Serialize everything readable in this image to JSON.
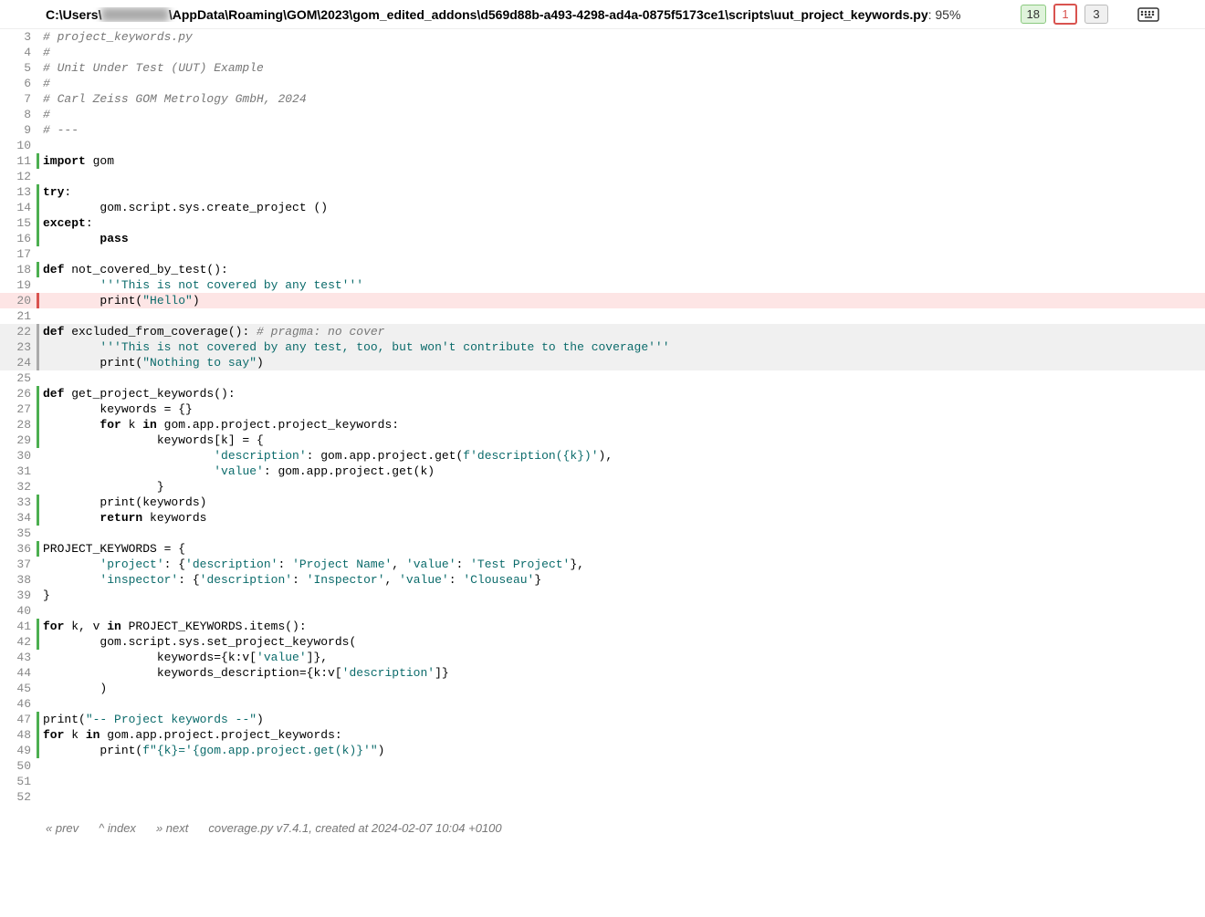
{
  "header": {
    "path_prefix": "C:\\Users\\",
    "path_blur": "XXXXXXX",
    "path_suffix": "\\AppData\\Roaming\\GOM\\2023\\gom_edited_addons\\d569d88b-a493-4298-ad4a-0875f5173ce1\\scripts\\uut_project_keywords.py",
    "pct_label": ": 95%",
    "stat_run": "18",
    "stat_miss": "1",
    "stat_excl": "3"
  },
  "lines": [
    {
      "n": 3,
      "cov": "",
      "tokens": [
        [
          "c",
          "# project_keywords.py"
        ]
      ]
    },
    {
      "n": 4,
      "cov": "",
      "tokens": [
        [
          "c",
          "#"
        ]
      ]
    },
    {
      "n": 5,
      "cov": "",
      "tokens": [
        [
          "c",
          "# Unit Under Test (UUT) Example"
        ]
      ]
    },
    {
      "n": 6,
      "cov": "",
      "tokens": [
        [
          "c",
          "#"
        ]
      ]
    },
    {
      "n": 7,
      "cov": "",
      "tokens": [
        [
          "c",
          "# Carl Zeiss GOM Metrology GmbH, 2024"
        ]
      ]
    },
    {
      "n": 8,
      "cov": "",
      "tokens": [
        [
          "c",
          "#"
        ]
      ]
    },
    {
      "n": 9,
      "cov": "",
      "tokens": [
        [
          "c",
          "# ---"
        ]
      ]
    },
    {
      "n": 10,
      "cov": "",
      "tokens": []
    },
    {
      "n": 11,
      "cov": "run",
      "tokens": [
        [
          "k",
          "import"
        ],
        [
          "t",
          " gom"
        ]
      ]
    },
    {
      "n": 12,
      "cov": "",
      "tokens": []
    },
    {
      "n": 13,
      "cov": "run",
      "tokens": [
        [
          "k",
          "try"
        ],
        [
          "t",
          ":"
        ]
      ]
    },
    {
      "n": 14,
      "cov": "run",
      "tokens": [
        [
          "t",
          "        gom.script.sys.create_project ()"
        ]
      ]
    },
    {
      "n": 15,
      "cov": "run",
      "tokens": [
        [
          "k",
          "except"
        ],
        [
          "t",
          ":"
        ]
      ]
    },
    {
      "n": 16,
      "cov": "run",
      "tokens": [
        [
          "t",
          "        "
        ],
        [
          "k",
          "pass"
        ]
      ]
    },
    {
      "n": 17,
      "cov": "",
      "tokens": []
    },
    {
      "n": 18,
      "cov": "run",
      "tokens": [
        [
          "k",
          "def"
        ],
        [
          "t",
          " not_covered_by_test():"
        ]
      ]
    },
    {
      "n": 19,
      "cov": "",
      "tokens": [
        [
          "t",
          "        "
        ],
        [
          "s",
          "'''This is not covered by any test'''"
        ]
      ]
    },
    {
      "n": 20,
      "cov": "miss",
      "tokens": [
        [
          "t",
          "        print("
        ],
        [
          "s",
          "\"Hello\""
        ],
        [
          "t",
          ")"
        ]
      ]
    },
    {
      "n": 21,
      "cov": "",
      "tokens": []
    },
    {
      "n": 22,
      "cov": "excl",
      "tokens": [
        [
          "k",
          "def"
        ],
        [
          "t",
          " excluded_from_coverage(): "
        ],
        [
          "c",
          "# pragma: no cover"
        ]
      ]
    },
    {
      "n": 23,
      "cov": "excl",
      "tokens": [
        [
          "t",
          "        "
        ],
        [
          "s",
          "'''This is not covered by any test, too, but won't contribute to the coverage'''"
        ]
      ]
    },
    {
      "n": 24,
      "cov": "excl",
      "tokens": [
        [
          "t",
          "        print("
        ],
        [
          "s",
          "\"Nothing to say\""
        ],
        [
          "t",
          ")"
        ]
      ]
    },
    {
      "n": 25,
      "cov": "",
      "tokens": []
    },
    {
      "n": 26,
      "cov": "run",
      "tokens": [
        [
          "k",
          "def"
        ],
        [
          "t",
          " get_project_keywords():"
        ]
      ]
    },
    {
      "n": 27,
      "cov": "run",
      "tokens": [
        [
          "t",
          "        keywords = {}"
        ]
      ]
    },
    {
      "n": 28,
      "cov": "run",
      "tokens": [
        [
          "t",
          "        "
        ],
        [
          "k",
          "for"
        ],
        [
          "t",
          " k "
        ],
        [
          "k",
          "in"
        ],
        [
          "t",
          " gom.app.project.project_keywords:"
        ]
      ]
    },
    {
      "n": 29,
      "cov": "run",
      "tokens": [
        [
          "t",
          "                keywords[k] = {"
        ]
      ]
    },
    {
      "n": 30,
      "cov": "",
      "tokens": [
        [
          "t",
          "                        "
        ],
        [
          "s",
          "'description'"
        ],
        [
          "t",
          ": gom.app.project.get("
        ],
        [
          "s",
          "f'description({k})'"
        ],
        [
          "t",
          "),"
        ]
      ]
    },
    {
      "n": 31,
      "cov": "",
      "tokens": [
        [
          "t",
          "                        "
        ],
        [
          "s",
          "'value'"
        ],
        [
          "t",
          ": gom.app.project.get(k)"
        ]
      ]
    },
    {
      "n": 32,
      "cov": "",
      "tokens": [
        [
          "t",
          "                }"
        ]
      ]
    },
    {
      "n": 33,
      "cov": "run",
      "tokens": [
        [
          "t",
          "        print(keywords)"
        ]
      ]
    },
    {
      "n": 34,
      "cov": "run",
      "tokens": [
        [
          "t",
          "        "
        ],
        [
          "k",
          "return"
        ],
        [
          "t",
          " keywords"
        ]
      ]
    },
    {
      "n": 35,
      "cov": "",
      "tokens": []
    },
    {
      "n": 36,
      "cov": "run",
      "tokens": [
        [
          "t",
          "PROJECT_KEYWORDS = {"
        ]
      ]
    },
    {
      "n": 37,
      "cov": "",
      "tokens": [
        [
          "t",
          "        "
        ],
        [
          "s",
          "'project'"
        ],
        [
          "t",
          ": {"
        ],
        [
          "s",
          "'description'"
        ],
        [
          "t",
          ": "
        ],
        [
          "s",
          "'Project Name'"
        ],
        [
          "t",
          ", "
        ],
        [
          "s",
          "'value'"
        ],
        [
          "t",
          ": "
        ],
        [
          "s",
          "'Test Project'"
        ],
        [
          "t",
          "},"
        ]
      ]
    },
    {
      "n": 38,
      "cov": "",
      "tokens": [
        [
          "t",
          "        "
        ],
        [
          "s",
          "'inspector'"
        ],
        [
          "t",
          ": {"
        ],
        [
          "s",
          "'description'"
        ],
        [
          "t",
          ": "
        ],
        [
          "s",
          "'Inspector'"
        ],
        [
          "t",
          ", "
        ],
        [
          "s",
          "'value'"
        ],
        [
          "t",
          ": "
        ],
        [
          "s",
          "'Clouseau'"
        ],
        [
          "t",
          "}"
        ]
      ]
    },
    {
      "n": 39,
      "cov": "",
      "tokens": [
        [
          "t",
          "}"
        ]
      ]
    },
    {
      "n": 40,
      "cov": "",
      "tokens": []
    },
    {
      "n": 41,
      "cov": "run",
      "tokens": [
        [
          "k",
          "for"
        ],
        [
          "t",
          " k, v "
        ],
        [
          "k",
          "in"
        ],
        [
          "t",
          " PROJECT_KEYWORDS.items():"
        ]
      ]
    },
    {
      "n": 42,
      "cov": "run",
      "tokens": [
        [
          "t",
          "        gom.script.sys.set_project_keywords("
        ]
      ]
    },
    {
      "n": 43,
      "cov": "",
      "tokens": [
        [
          "t",
          "                keywords={k:v["
        ],
        [
          "s",
          "'value'"
        ],
        [
          "t",
          "]},"
        ]
      ]
    },
    {
      "n": 44,
      "cov": "",
      "tokens": [
        [
          "t",
          "                keywords_description={k:v["
        ],
        [
          "s",
          "'description'"
        ],
        [
          "t",
          "]}"
        ]
      ]
    },
    {
      "n": 45,
      "cov": "",
      "tokens": [
        [
          "t",
          "        )"
        ]
      ]
    },
    {
      "n": 46,
      "cov": "",
      "tokens": []
    },
    {
      "n": 47,
      "cov": "run",
      "tokens": [
        [
          "t",
          "print("
        ],
        [
          "s",
          "\"-- Project keywords --\""
        ],
        [
          "t",
          ")"
        ]
      ]
    },
    {
      "n": 48,
      "cov": "run",
      "tokens": [
        [
          "k",
          "for"
        ],
        [
          "t",
          " k "
        ],
        [
          "k",
          "in"
        ],
        [
          "t",
          " gom.app.project.project_keywords:"
        ]
      ]
    },
    {
      "n": 49,
      "cov": "run",
      "tokens": [
        [
          "t",
          "        print("
        ],
        [
          "s",
          "f\"{k}='{gom.app.project.get(k)}'\""
        ],
        [
          "t",
          ")"
        ]
      ]
    },
    {
      "n": 50,
      "cov": "",
      "tokens": []
    },
    {
      "n": 51,
      "cov": "",
      "tokens": []
    },
    {
      "n": 52,
      "cov": "",
      "tokens": []
    }
  ],
  "footer": {
    "prev": "« prev",
    "index": "^ index",
    "next": "» next",
    "generator": "coverage.py v7.4.1, created at 2024-02-07 10:04 +0100"
  }
}
